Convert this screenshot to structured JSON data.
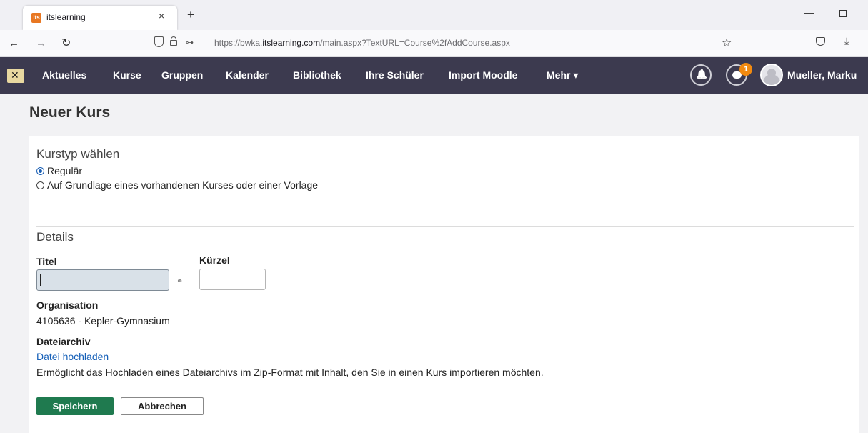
{
  "browser": {
    "tab_title": "itslearning",
    "tab_favicon": "its",
    "tab_close": "×",
    "new_tab": "+",
    "url_prefix": "https://bwka.",
    "url_domain": "itslearning.com",
    "url_path": "/main.aspx?TextURL=Course%2fAddCourse.aspx"
  },
  "header": {
    "nav": [
      "Aktuelles",
      "Kurse",
      "Gruppen",
      "Kalender",
      "Bibliothek",
      "Ihre Schüler",
      "Import Moodle",
      "Mehr ▾"
    ],
    "notification_count": "1",
    "user_name": "Mueller, Marku"
  },
  "page": {
    "title": "Neuer Kurs",
    "course_type": {
      "heading": "Kurstyp wählen",
      "options": [
        "Regulär",
        "Auf Grundlage eines vorhandenen Kurses oder einer Vorlage"
      ],
      "selected": "Regulär"
    },
    "details": {
      "heading": "Details",
      "title_label": "Titel",
      "title_value": "",
      "short_label": "Kürzel",
      "short_value": "",
      "org_label": "Organisation",
      "org_value": "4105636 - Kepler-Gymnasium",
      "archive_label": "Dateiarchiv",
      "upload_link": "Datei hochladen",
      "archive_help": "Ermöglicht das Hochladen eines Dateiarchivs im Zip-Format mit Inhalt, den Sie in einen Kurs importieren möchten."
    },
    "buttons": {
      "save": "Speichern",
      "cancel": "Abbrechen"
    }
  },
  "colors": {
    "header_bg": "#3c3a4f",
    "badge": "#f28a10",
    "save_button": "#1f7a4f",
    "link": "#1660b8"
  }
}
